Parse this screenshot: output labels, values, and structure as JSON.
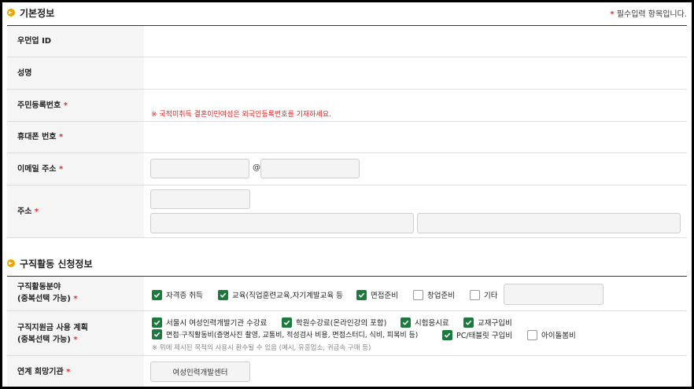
{
  "section1": {
    "title": "기본정보",
    "required_note": "필수입력 항목입니다.",
    "star": "*"
  },
  "fields": {
    "woman_id": "우먼업 ID",
    "name": "성명",
    "resident_no": "주민등록번호",
    "resident_notice": "※ 국적미취득 결혼이민여성은 외국인등록번호를 기재하세요.",
    "phone": "휴대폰 번호",
    "email": "이메일 주소",
    "email_at": "@",
    "address": "주소"
  },
  "section2": {
    "title": "구직활동 신청정보",
    "field_label_1": "구직활동분야",
    "field_label_2": "(중복선택 가능)",
    "field_options": [
      {
        "label": "자격증 취득",
        "checked": true
      },
      {
        "label": "교육(직업훈련교육,자기계발교육 등",
        "checked": true
      },
      {
        "label": "면접준비",
        "checked": true
      },
      {
        "label": "창업준비",
        "checked": false
      },
      {
        "label": "기타",
        "checked": false
      }
    ],
    "plan_label_1": "구직지원금 사용 계획",
    "plan_label_2": "(중복선택 가능)",
    "plan_options": [
      {
        "label": "서울시 여성인력개발기관 수강료",
        "checked": true
      },
      {
        "label": "학원수강료(온라인강의 포함)",
        "checked": true
      },
      {
        "label": "시험응시료",
        "checked": true
      },
      {
        "label": "교재구입비",
        "checked": true
      },
      {
        "label": "면접·구직활동비(증명사진 촬영, 교통비, 적성검사 비용, 면접스터디, 식비, 피복비 등)",
        "checked": true
      },
      {
        "label": "PC/태블릿 구입비",
        "checked": true
      },
      {
        "label": "아이돌봄비",
        "checked": false
      }
    ],
    "plan_note": "※ 위에 제시된 목적의 사용시 환수될 수 있음 (예시, 유흥업소, 귀금속 구매 등)",
    "linked_label": "연계 희망기관",
    "linked_button": "여성인력개발센터"
  }
}
